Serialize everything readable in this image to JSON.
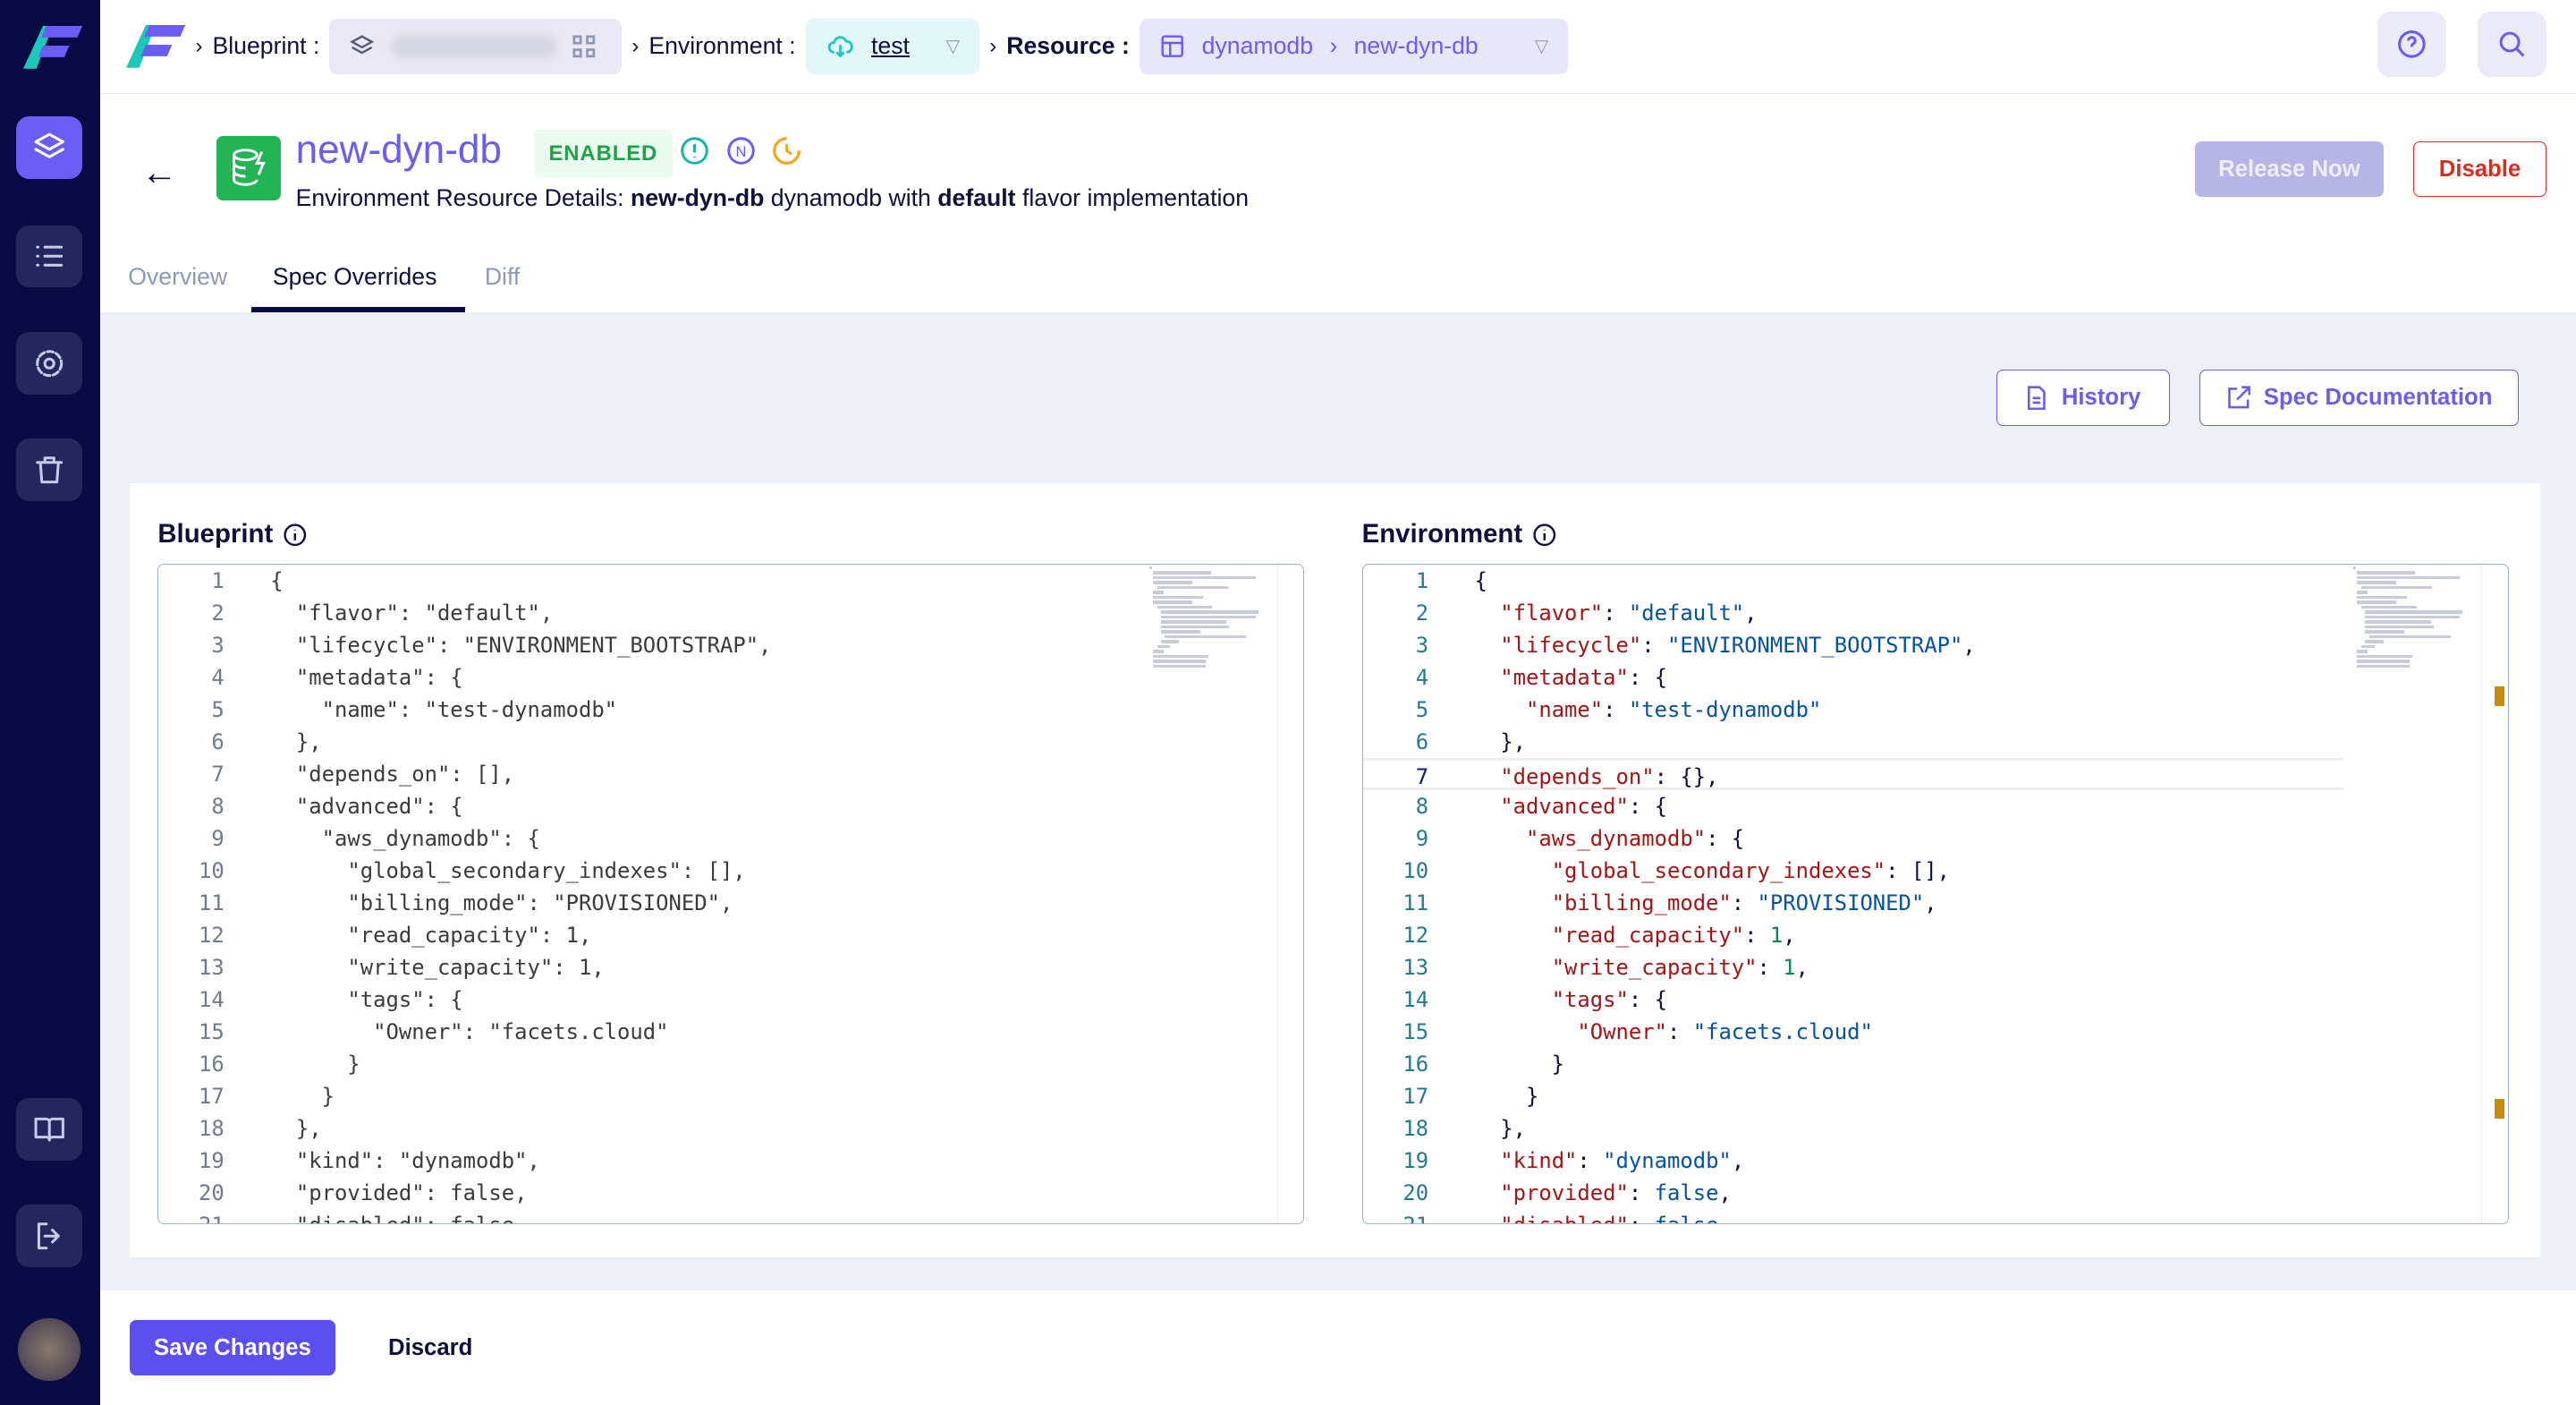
{
  "colors": {
    "accent": "#6a5df3",
    "sidebar": "#0a0b45",
    "enabled": "#1fa34a",
    "danger": "#d92d20"
  },
  "sidebar": {
    "items": [
      {
        "icon": "layers-icon",
        "active": true
      },
      {
        "icon": "list-icon"
      },
      {
        "icon": "gear-icon"
      },
      {
        "icon": "trash-icon"
      },
      {
        "icon": "book-icon"
      },
      {
        "icon": "logout-icon"
      }
    ]
  },
  "breadcrumb": {
    "blueprint_label": "Blueprint :",
    "environment_label": "Environment :",
    "environment_value": "test",
    "resource_label": "Resource :",
    "resource_type": "dynamodb",
    "resource_name": "new-dyn-db"
  },
  "header": {
    "title": "new-dyn-db",
    "status": "ENABLED",
    "subtitle_prefix": "Environment Resource Details: ",
    "subtitle_name": "new-dyn-db",
    "subtitle_mid": " dynamodb with ",
    "subtitle_flavor": "default",
    "subtitle_suffix": " flavor implementation",
    "release_button": "Release Now",
    "disable_button": "Disable"
  },
  "tabs": [
    {
      "label": "Overview"
    },
    {
      "label": "Spec Overrides",
      "active": true
    },
    {
      "label": "Diff"
    }
  ],
  "toolbar": {
    "history": "History",
    "spec_docs": "Spec Documentation"
  },
  "blueprint": {
    "title": "Blueprint",
    "lines": [
      "{",
      "  \"flavor\": \"default\",",
      "  \"lifecycle\": \"ENVIRONMENT_BOOTSTRAP\",",
      "  \"metadata\": {",
      "    \"name\": \"test-dynamodb\"",
      "  },",
      "  \"depends_on\": [],",
      "  \"advanced\": {",
      "    \"aws_dynamodb\": {",
      "      \"global_secondary_indexes\": [],",
      "      \"billing_mode\": \"PROVISIONED\",",
      "      \"read_capacity\": 1,",
      "      \"write_capacity\": 1,",
      "      \"tags\": {",
      "        \"Owner\": \"facets.cloud\"",
      "      }",
      "    }",
      "  },",
      "  \"kind\": \"dynamodb\",",
      "  \"provided\": false,",
      "  \"disabled\": false,"
    ]
  },
  "environment": {
    "title": "Environment",
    "lines": [
      "{",
      "  \"flavor\": \"default\",",
      "  \"lifecycle\": \"ENVIRONMENT_BOOTSTRAP\",",
      "  \"metadata\": {",
      "    \"name\": \"test-dynamodb\"",
      "  },",
      "  \"depends_on\": {},",
      "  \"advanced\": {",
      "    \"aws_dynamodb\": {",
      "      \"global_secondary_indexes\": [],",
      "      \"billing_mode\": \"PROVISIONED\",",
      "      \"read_capacity\": 1,",
      "      \"write_capacity\": 1,",
      "      \"tags\": {",
      "        \"Owner\": \"facets.cloud\"",
      "      }",
      "    }",
      "  },",
      "  \"kind\": \"dynamodb\",",
      "  \"provided\": false,",
      "  \"disabled\": false,"
    ]
  },
  "footer": {
    "save": "Save Changes",
    "discard": "Discard"
  }
}
